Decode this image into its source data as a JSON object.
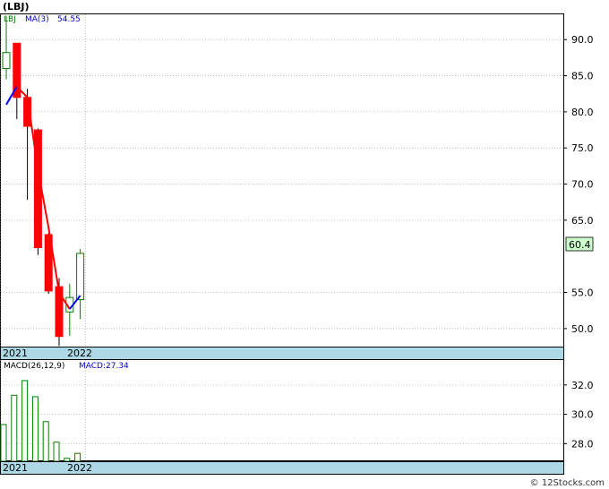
{
  "ticker": "(LBJ)",
  "price_panel": {
    "legend_symbol": "LBJ",
    "legend_ma": "MA(3)",
    "legend_ma_value": "54.55",
    "current_price_label": "60.4",
    "y_ticks": [
      "90.0",
      "85.0",
      "80.0",
      "75.0",
      "70.0",
      "65.0",
      "55.0",
      "50.0"
    ]
  },
  "macd_panel": {
    "legend_label": "MACD(26,12,9)",
    "legend_value": "MACD:27.34",
    "y_ticks": [
      "32.0",
      "30.0",
      "28.0"
    ]
  },
  "x_axis_labels": [
    "2021",
    "2022"
  ],
  "watermark": "© 12Stocks.com",
  "colors": {
    "up": "#008000",
    "down": "#ff0000",
    "ma_up": "#0000ff",
    "ma_down": "#ff0000",
    "macd_bar": "#008000",
    "axis_band": "#add8e6",
    "price_tag_bg": "#ccffcc"
  },
  "chart_data": [
    {
      "type": "candlestick",
      "title": "(LBJ)",
      "ylim": [
        47.5,
        93.5
      ],
      "y_ticks": [
        90,
        85,
        80,
        75,
        70,
        65,
        55,
        50
      ],
      "candles": [
        {
          "open": 86.0,
          "close": 88.2,
          "high": 93.3,
          "low": 84.5
        },
        {
          "open": 89.5,
          "close": 82.0,
          "high": 89.5,
          "low": 79.0
        },
        {
          "open": 82.0,
          "close": 78.0,
          "high": 83.2,
          "low": 67.8
        },
        {
          "open": 77.5,
          "close": 61.2,
          "high": 77.7,
          "low": 60.2
        },
        {
          "open": 63.0,
          "close": 55.2,
          "high": 63.2,
          "low": 54.8
        },
        {
          "open": 55.8,
          "close": 48.9,
          "high": 57.0,
          "low": 47.6
        },
        {
          "open": 52.3,
          "close": 54.3,
          "high": 56.2,
          "low": 49.0
        },
        {
          "open": 54.0,
          "close": 60.4,
          "high": 61.0,
          "low": 51.3
        }
      ],
      "ma3": [
        81.0,
        83.5,
        82.0,
        72.0,
        64.0,
        55.0,
        52.7,
        54.55
      ],
      "x_labels": [
        {
          "label": "2021",
          "index": 0
        },
        {
          "label": "2022",
          "index": 7
        }
      ]
    },
    {
      "type": "bar",
      "title": "MACD(26,12,9)",
      "ylim": [
        26.8,
        33.7
      ],
      "y_ticks": [
        32.0,
        30.0,
        28.0
      ],
      "values": [
        29.3,
        31.3,
        32.3,
        31.2,
        29.5,
        28.1,
        27.0,
        27.34
      ]
    }
  ]
}
